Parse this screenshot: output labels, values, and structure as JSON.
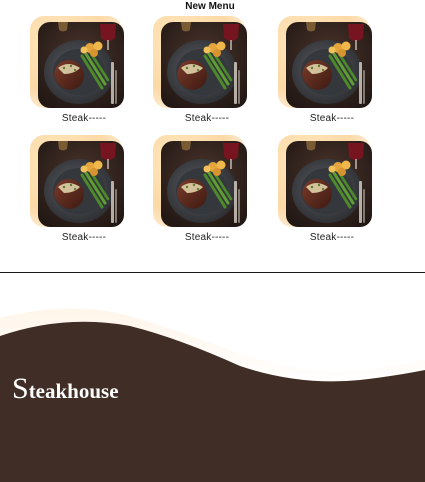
{
  "menu": {
    "title": "New Menu",
    "items": [
      {
        "label": "Steak-----",
        "image": "steak-dinner-photo"
      },
      {
        "label": "Steak-----",
        "image": "steak-dinner-photo"
      },
      {
        "label": "Steak-----",
        "image": "steak-dinner-photo"
      },
      {
        "label": "Steak-----",
        "image": "steak-dinner-photo"
      },
      {
        "label": "Steak-----",
        "image": "steak-dinner-photo"
      },
      {
        "label": "Steak-----",
        "image": "steak-dinner-photo"
      }
    ]
  },
  "footer": {
    "brand_initial": "S",
    "brand_rest": "teakhouse",
    "background_color": "#3f2d26",
    "accent_glow": "#fcd9a6"
  }
}
